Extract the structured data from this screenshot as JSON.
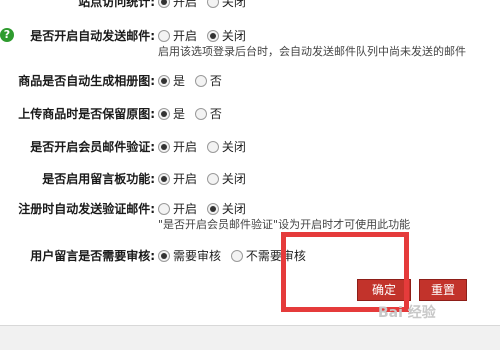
{
  "rows": {
    "site_stats": {
      "label": "站点访问统计:",
      "options": [
        "开启",
        "关闭"
      ],
      "selected": 0
    },
    "auto_mail": {
      "label": "是否开启自动发送邮件:",
      "options": [
        "开启",
        "关闭"
      ],
      "selected": 1,
      "hint": "启用该选项登录后台时，会自动发送邮件队列中尚未发送的邮件"
    },
    "auto_album": {
      "label": "商品是否自动生成相册图:",
      "options": [
        "是",
        "否"
      ],
      "selected": 0
    },
    "keep_original": {
      "label": "上传商品时是否保留原图:",
      "options": [
        "是",
        "否"
      ],
      "selected": 0
    },
    "member_verify": {
      "label": "是否开启会员邮件验证:",
      "options": [
        "开启",
        "关闭"
      ],
      "selected": 0
    },
    "guestbook": {
      "label": "是否启用留言板功能:",
      "options": [
        "开启",
        "关闭"
      ],
      "selected": 0
    },
    "register_verify": {
      "label": "注册时自动发送验证邮件:",
      "options": [
        "开启",
        "关闭"
      ],
      "selected": 1,
      "hint": "\"是否开启会员邮件验证\"设为开启时才可使用此功能"
    },
    "message_audit": {
      "label": "用户留言是否需要审核:",
      "options": [
        "需要审核",
        "不需要审核"
      ],
      "selected": 0
    }
  },
  "buttons": {
    "confirm": "确定",
    "reset": "重置"
  },
  "icons": {
    "help": "help-icon"
  },
  "colors": {
    "button": "#c2332b",
    "highlight": "#e53b3b",
    "help": "#2e9b2e"
  },
  "watermark": "Bai 经验"
}
